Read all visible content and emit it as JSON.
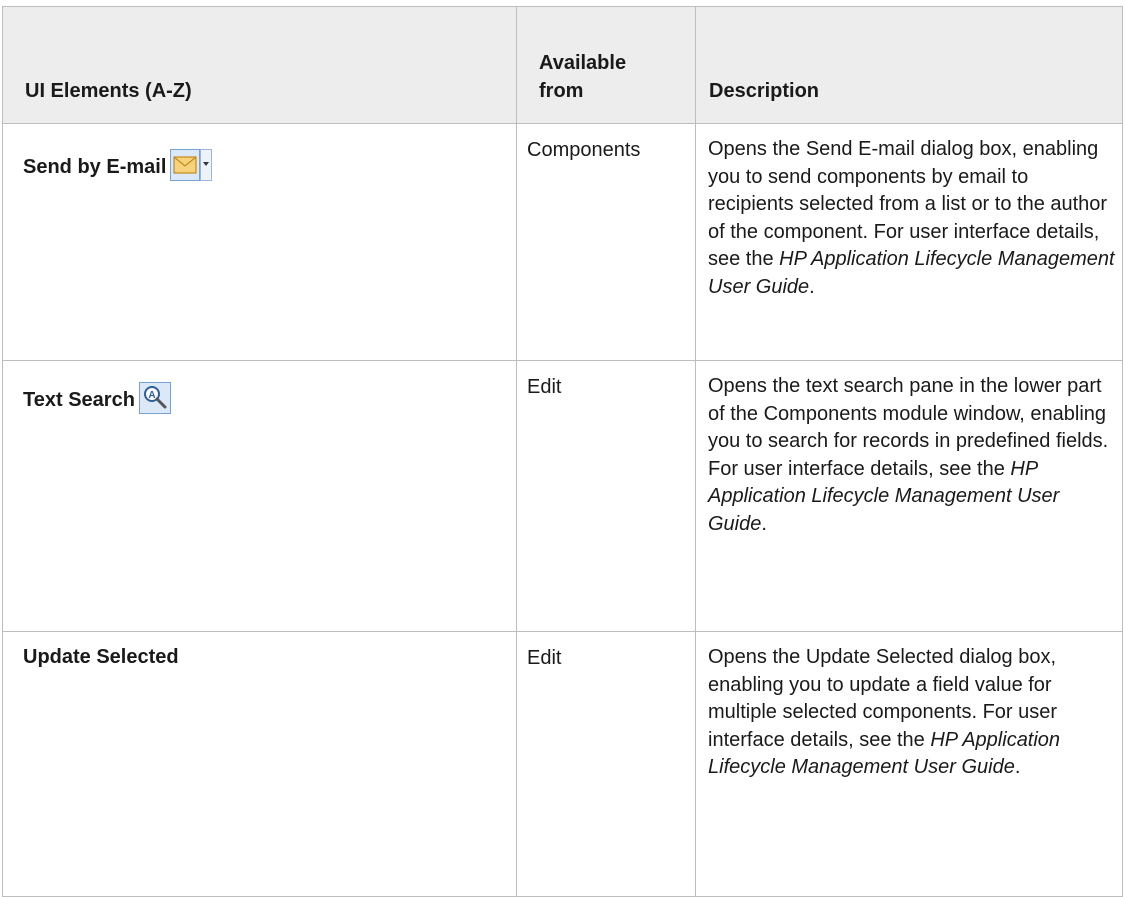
{
  "table": {
    "headers": {
      "col1": "UI Elements (A-Z)",
      "col2_line1": "Available",
      "col2_line2": "from",
      "col3": "Description"
    },
    "rows": [
      {
        "element": "Send by E-mail",
        "icon": "envelope-dropdown-icon",
        "available_from": "Components",
        "description_before": "Opens the Send E-mail dialog box, enabling you to send components by email to recipients selected from a list or to the author of the component. For user interface details, see the ",
        "description_guide": "HP Application Lifecycle Management User Guide",
        "description_after": "."
      },
      {
        "element": "Text Search",
        "icon": "text-search-icon",
        "available_from": "Edit",
        "description_before": "Opens the text search pane in the lower part of the Components module window, enabling you to search for records in predefined fields. For user interface details, see the ",
        "description_guide": "HP Application Lifecycle Management User Guide",
        "description_after": "."
      },
      {
        "element": "Update Selected",
        "icon": "",
        "available_from": "Edit",
        "description_before": "Opens the Update Selected dialog box, enabling you to update a field value for multiple selected components. For user interface details, see the ",
        "description_guide": "HP Application Lifecycle Management User Guide",
        "description_after": "."
      }
    ]
  },
  "colors": {
    "header_bg": "#ededed",
    "border": "#bdbdbd",
    "icon_button_bg": "#dbe8f7",
    "icon_button_border": "#7aa2cf",
    "envelope_fill": "#f6d37a",
    "envelope_stroke": "#c48a1c"
  }
}
